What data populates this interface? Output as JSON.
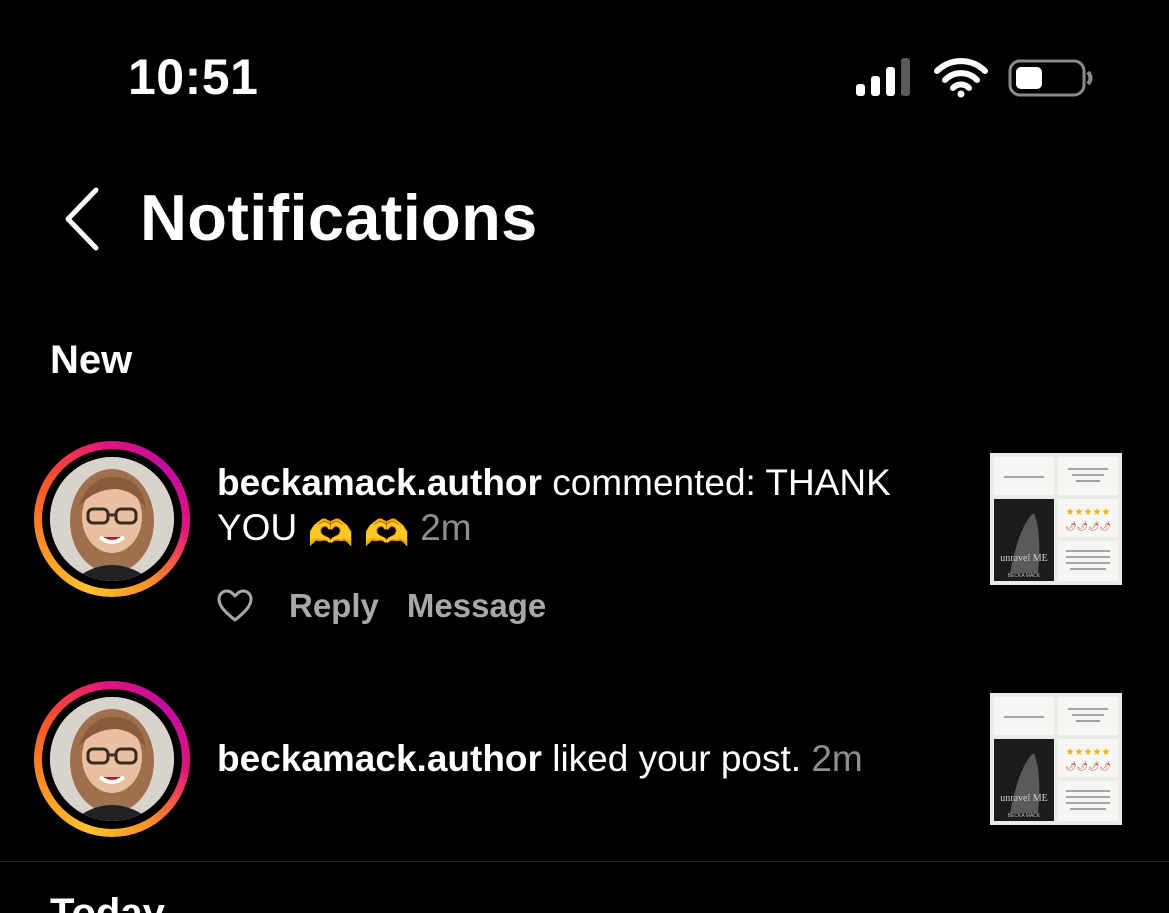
{
  "status_bar": {
    "time": "10:51"
  },
  "header": {
    "title": "Notifications"
  },
  "sections": {
    "new_label": "New",
    "today_label": "Today"
  },
  "notifications": [
    {
      "username": "beckamack.author",
      "text": "commented: THANK YOU",
      "emoji": [
        "🫶",
        "🫶"
      ],
      "time": "2m",
      "actions": {
        "reply": "Reply",
        "message": "Message"
      }
    },
    {
      "username": "beckamack.author",
      "text": "liked your post.",
      "time": "2m"
    }
  ],
  "thumbnail": {
    "book_title": "unravel ME",
    "author": "BECKA MACK"
  },
  "colors": {
    "background": "#000000",
    "secondary_text": "#8e8e8e",
    "story_ring": [
      "#fdc230",
      "#f8502e",
      "#c30da1"
    ]
  }
}
